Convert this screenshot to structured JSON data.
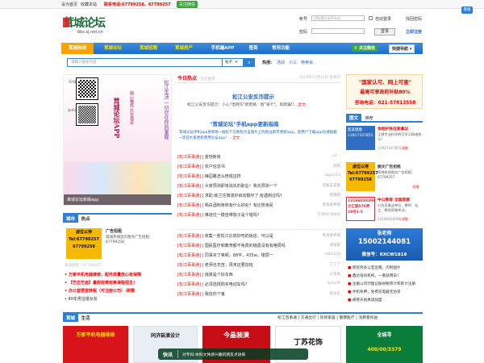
{
  "topbar": {
    "set_home": "设为首页",
    "favorite": "收藏本站",
    "contact": "联系电话:67799258、67799257",
    "follow_btn": "关注微信"
  },
  "login": {
    "account_label": "帐号",
    "account_placeholder": "UID/用户名/Email",
    "auto_login": "自动登录",
    "find_password": "找回密码",
    "password_label": "密码",
    "login_btn": "登录",
    "register": "立即注册"
  },
  "header": {
    "logo_text": "茸城论坛",
    "logo_url": "bbs.sj.net.cn"
  },
  "nav": {
    "items": [
      "茸城热线",
      "茸城论坛",
      "茸城招聘",
      "茸城房产",
      "手机端APP",
      "签到",
      "常用功能"
    ],
    "follow": "关注微信",
    "quick": "快捷导航"
  },
  "search": {
    "placeholder": "请输入搜索内容",
    "type": "帖子",
    "hot_label": "热搜:",
    "hot_items": [
      "活动",
      "小三",
      "特卖会"
    ]
  },
  "feature_image": {
    "caption": "茸城论坛新版app",
    "poem": "松江生活 一切尽在你的掌握",
    "slogan": "随心触控 乐在指尖",
    "brand": "茸城论坛APP",
    "qr1_label": "IOS版",
    "qr2_label": "安卓版"
  },
  "today": {
    "title": "今日热点",
    "sub": "热点推荐",
    "date": "2018年11月11日 星期日",
    "headline": "松江公安反诈提示",
    "summary": "松江公安反诈提示：小心\"电网诈\"新套路：假\"骑卡\"，真欺骗!!",
    "summary_more": "全文",
    "headline2": "\"茸城论坛\"手机app更新指南",
    "summary2": "茸城论坛手机app更新啦~按照下方教程点击图片上的地址即可更新app，新用户下载app也请猛戳~欢迎大家更新使用论坛app！",
    "summary2_more": "全文",
    "news": [
      {
        "tag": "[松江百事通]",
        "title": "金地新房",
        "author": "n2..."
      },
      {
        "tag": "[松江百事通]",
        "title": "农户信息书",
        "author": "韵晓"
      },
      {
        "tag": "[松江百事通]",
        "title": "梅园路怎么修成这样",
        "author": "lwg1215"
      },
      {
        "tag": "[松江百事通]",
        "title": "大家预测即将消失的职业！我先预测一个",
        "author": "无敌菜菜家"
      },
      {
        "tag": "[松江百事通]",
        "title": "求助:栋兰住微波炉启动键坏了,有遇到过吗?",
        "author": "刺猬猪"
      },
      {
        "tag": "[松江百事通]",
        "title": "喝白酒到身体有什么好处？有比较亲民",
        "author": "更具爱养猪"
      },
      {
        "tag": "[松江百事通]",
        "title": "难道住一楼自带院子是个错吗？",
        "author": "丁刘9178806"
      }
    ],
    "news2": [
      {
        "tag": "[松江百事通]",
        "title": "收集一些松江比较好吃的饭店，可以是",
        "author": "更具爱养猪"
      },
      {
        "tag": "[松江百事通]",
        "title": "国民医疗和教育都不免费的瑞嘉没有有格局吗",
        "author": "源泉家"
      },
      {
        "tag": "[松江百事通]",
        "title": "同事买了茉顿，88平，435w，楼层一",
        "author": "zlili1520"
      },
      {
        "tag": "[松江百事通]",
        "title": "老师也辛苦，周末还要加班",
        "author": "了了了"
      },
      {
        "tag": "[松江百事通]",
        "title": "钱真是个好东西",
        "author": "小苹果"
      },
      {
        "tag": "[松江百事通]",
        "title": "必须选择购买电动车吗？",
        "author": "liyiouPt"
      },
      {
        "tag": "[松江百事通]",
        "title": "我信你个鬼",
        "author": "恐龙乐"
      }
    ]
  },
  "right_ad": {
    "line1": "\"国家认可、网上可查\"",
    "line2": "最高可享政府补贴80%",
    "line3": "咨询电话：021-57813558"
  },
  "picture": {
    "title": "图文",
    "sub": "推荐",
    "items": [
      {
        "img_text": "医美健康 13917337855",
        "title": "金程护肤在家拿证",
        "desc": "正规专业科学的可学习网络参与!",
        "phone": "13917337855",
        "detail": "详细"
      },
      {
        "img_text": "虚位以待 Tel:67799257 67799258",
        "title": "图文广告招租",
        "desc": "茸城热线图文广告招租：67799257",
        "detail": "详细"
      },
      {
        "img_text": "13166018398 文汇路576弄29号1-5",
        "title": "中公教育 全国直营",
        "desc": "公务员事业单位、教师、社工、教师资格考试。",
        "phone": "13166018398",
        "detail": "详细"
      }
    ],
    "banner_name": "张老师",
    "banner_phone": "15002144081",
    "banner_wechat": "微信号：RXCW1818",
    "links": [
      "新装修办公室出租，内附图片",
      "鑫达培训机构，一看就明白！",
      "注册公司代理记账财税审计和审计注册",
      "手机免押，免费充电器无仿货",
      "被寒天佑真诚加盟"
    ]
  },
  "city": {
    "title": "城市",
    "sub": "热点",
    "ad_img": "虚位以待 Tel:67799257 67799258",
    "ad_title": "广告招租",
    "ad_desc": "茸城热线首页图文广告招租：67799258",
    "more_tag": "真诚招租",
    "more_phone": "67799257",
    "hot": [
      "万家平机电器维修，配件质量放心有保障",
      "【艺庄艺画】暑假班寒班等课程招生！",
      "办公室便宜转租（可注册公司）-刚需",
      "80年男征婚女友"
    ]
  },
  "life": {
    "title": "茸城",
    "sub": "生活",
    "tabs": [
      "松江百事通",
      "交通出行",
      "装修家居",
      "健康医疗",
      "消费者权益"
    ],
    "cards": [
      "万家平机电器维修",
      "同济装潢设计",
      "今晶装潢",
      "丁苏花饰",
      "全城寻"
    ],
    "phone": "400/00/3379"
  },
  "ticker": {
    "label": "快讯",
    "text": "对专科·本科文凭感兴趣的朋友点进来"
  },
  "float_service": "客服"
}
